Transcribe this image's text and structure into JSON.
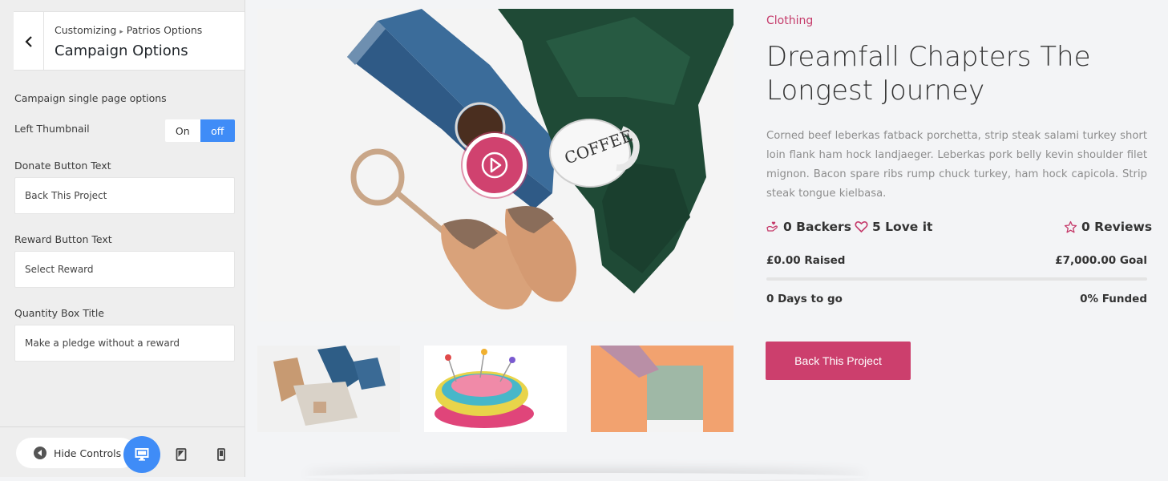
{
  "customizer": {
    "breadcrumb_root": "Customizing",
    "breadcrumb_sep": "▸",
    "breadcrumb_parent": "Patrios Options",
    "section_title": "Campaign Options",
    "group_label": "Campaign single page options",
    "left_thumbnail": {
      "label": "Left Thumbnail",
      "on_label": "On",
      "off_label": "off",
      "selected": "off"
    },
    "donate_button": {
      "label": "Donate Button Text",
      "value": "Back This Project"
    },
    "reward_button": {
      "label": "Reward Button Text",
      "value": "Select Reward"
    },
    "quantity_box": {
      "label": "Quantity Box Title",
      "value": "Make a pledge without a reward"
    },
    "footer": {
      "hide_controls_label": "Hide Controls",
      "active_device": "desktop"
    }
  },
  "campaign": {
    "category": "Clothing",
    "title": "Dreamfall Chapters The Longest Journey",
    "description": "Corned beef leberkas fatback porchetta, strip steak salami turkey short loin flank ham hock landjaeger. Leberkas pork belly kevin shoulder filet mignon. Bacon spare ribs rump chuck turkey, ham hock capicola. Strip steak tongue kielbasa.",
    "backers": "0 Backers",
    "love": "5 Love it",
    "reviews": "0 Reviews",
    "raised": "£0.00 Raised",
    "goal": "£7,000.00 Goal",
    "funded_fraction": 0,
    "days_to_go": "0 Days to go",
    "funded": "0% Funded",
    "back_button": "Back This Project"
  },
  "colors": {
    "accent": "#cc3f6d",
    "toggle_active": "#3f8cf7"
  }
}
